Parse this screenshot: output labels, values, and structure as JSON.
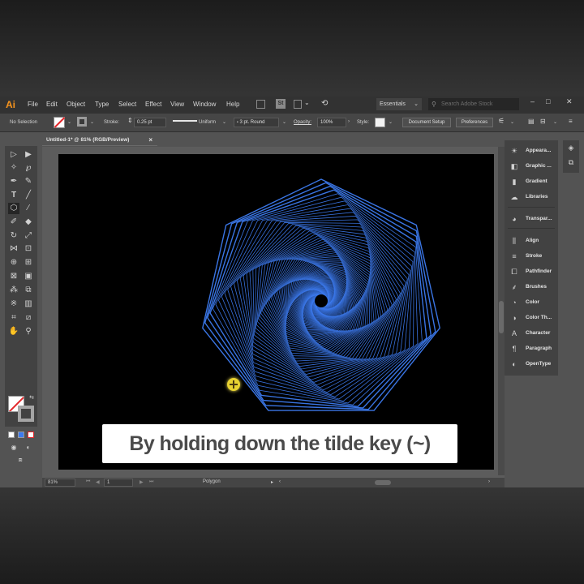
{
  "app": {
    "logo": "Ai",
    "menu": [
      "File",
      "Edit",
      "Object",
      "Type",
      "Select",
      "Effect",
      "View",
      "Window",
      "Help"
    ],
    "bridge_icon": "St",
    "workspace": "Essentials",
    "search_placeholder": "Search Adobe Stock",
    "window_controls": {
      "minimize": "–",
      "maximize": "□",
      "close": "✕"
    }
  },
  "control_bar": {
    "selection_status": "No Selection",
    "stroke_label": "Stroke:",
    "stroke_weight": "0.25 pt",
    "profile": "Uniform",
    "brush": "3 pt. Round",
    "opacity_label": "Opacity:",
    "opacity_value": "100%",
    "style_label": "Style:",
    "document_setup": "Document Setup",
    "preferences": "Preferences"
  },
  "document": {
    "tab_title": "Untitled-1* @ 81% (RGB/Preview)",
    "close": "×"
  },
  "status_bar": {
    "zoom": "81%",
    "artboard_number": "1",
    "current_tool": "Polygon"
  },
  "panels": [
    {
      "label": "Appeara...",
      "icon": "appearance-icon"
    },
    {
      "label": "Graphic ...",
      "icon": "graphic-styles-icon"
    },
    {
      "label": "Gradient",
      "icon": "gradient-icon"
    },
    {
      "label": "Libraries",
      "icon": "libraries-icon"
    },
    {
      "label": "Transpar...",
      "icon": "transparency-icon"
    },
    {
      "label": "Align",
      "icon": "align-icon"
    },
    {
      "label": "Stroke",
      "icon": "stroke-icon"
    },
    {
      "label": "Pathfinder",
      "icon": "pathfinder-icon"
    },
    {
      "label": "Brushes",
      "icon": "brushes-icon"
    },
    {
      "label": "Color",
      "icon": "color-icon"
    },
    {
      "label": "Color Th...",
      "icon": "color-theme-icon"
    },
    {
      "label": "Character",
      "icon": "character-icon"
    },
    {
      "label": "Paragraph",
      "icon": "paragraph-icon"
    },
    {
      "label": "OpenType",
      "icon": "opentype-icon"
    }
  ],
  "artwork": {
    "description_color": "#3d7bf0",
    "background": "#000000"
  },
  "caption": "By holding down the tilde key (~)",
  "colors": {
    "ui_dark": "#323232",
    "ui_mid": "#535353",
    "accent_logo": "#f7941d",
    "none_slash": "#e3262a",
    "cursor_yellow": "#e8d231"
  }
}
